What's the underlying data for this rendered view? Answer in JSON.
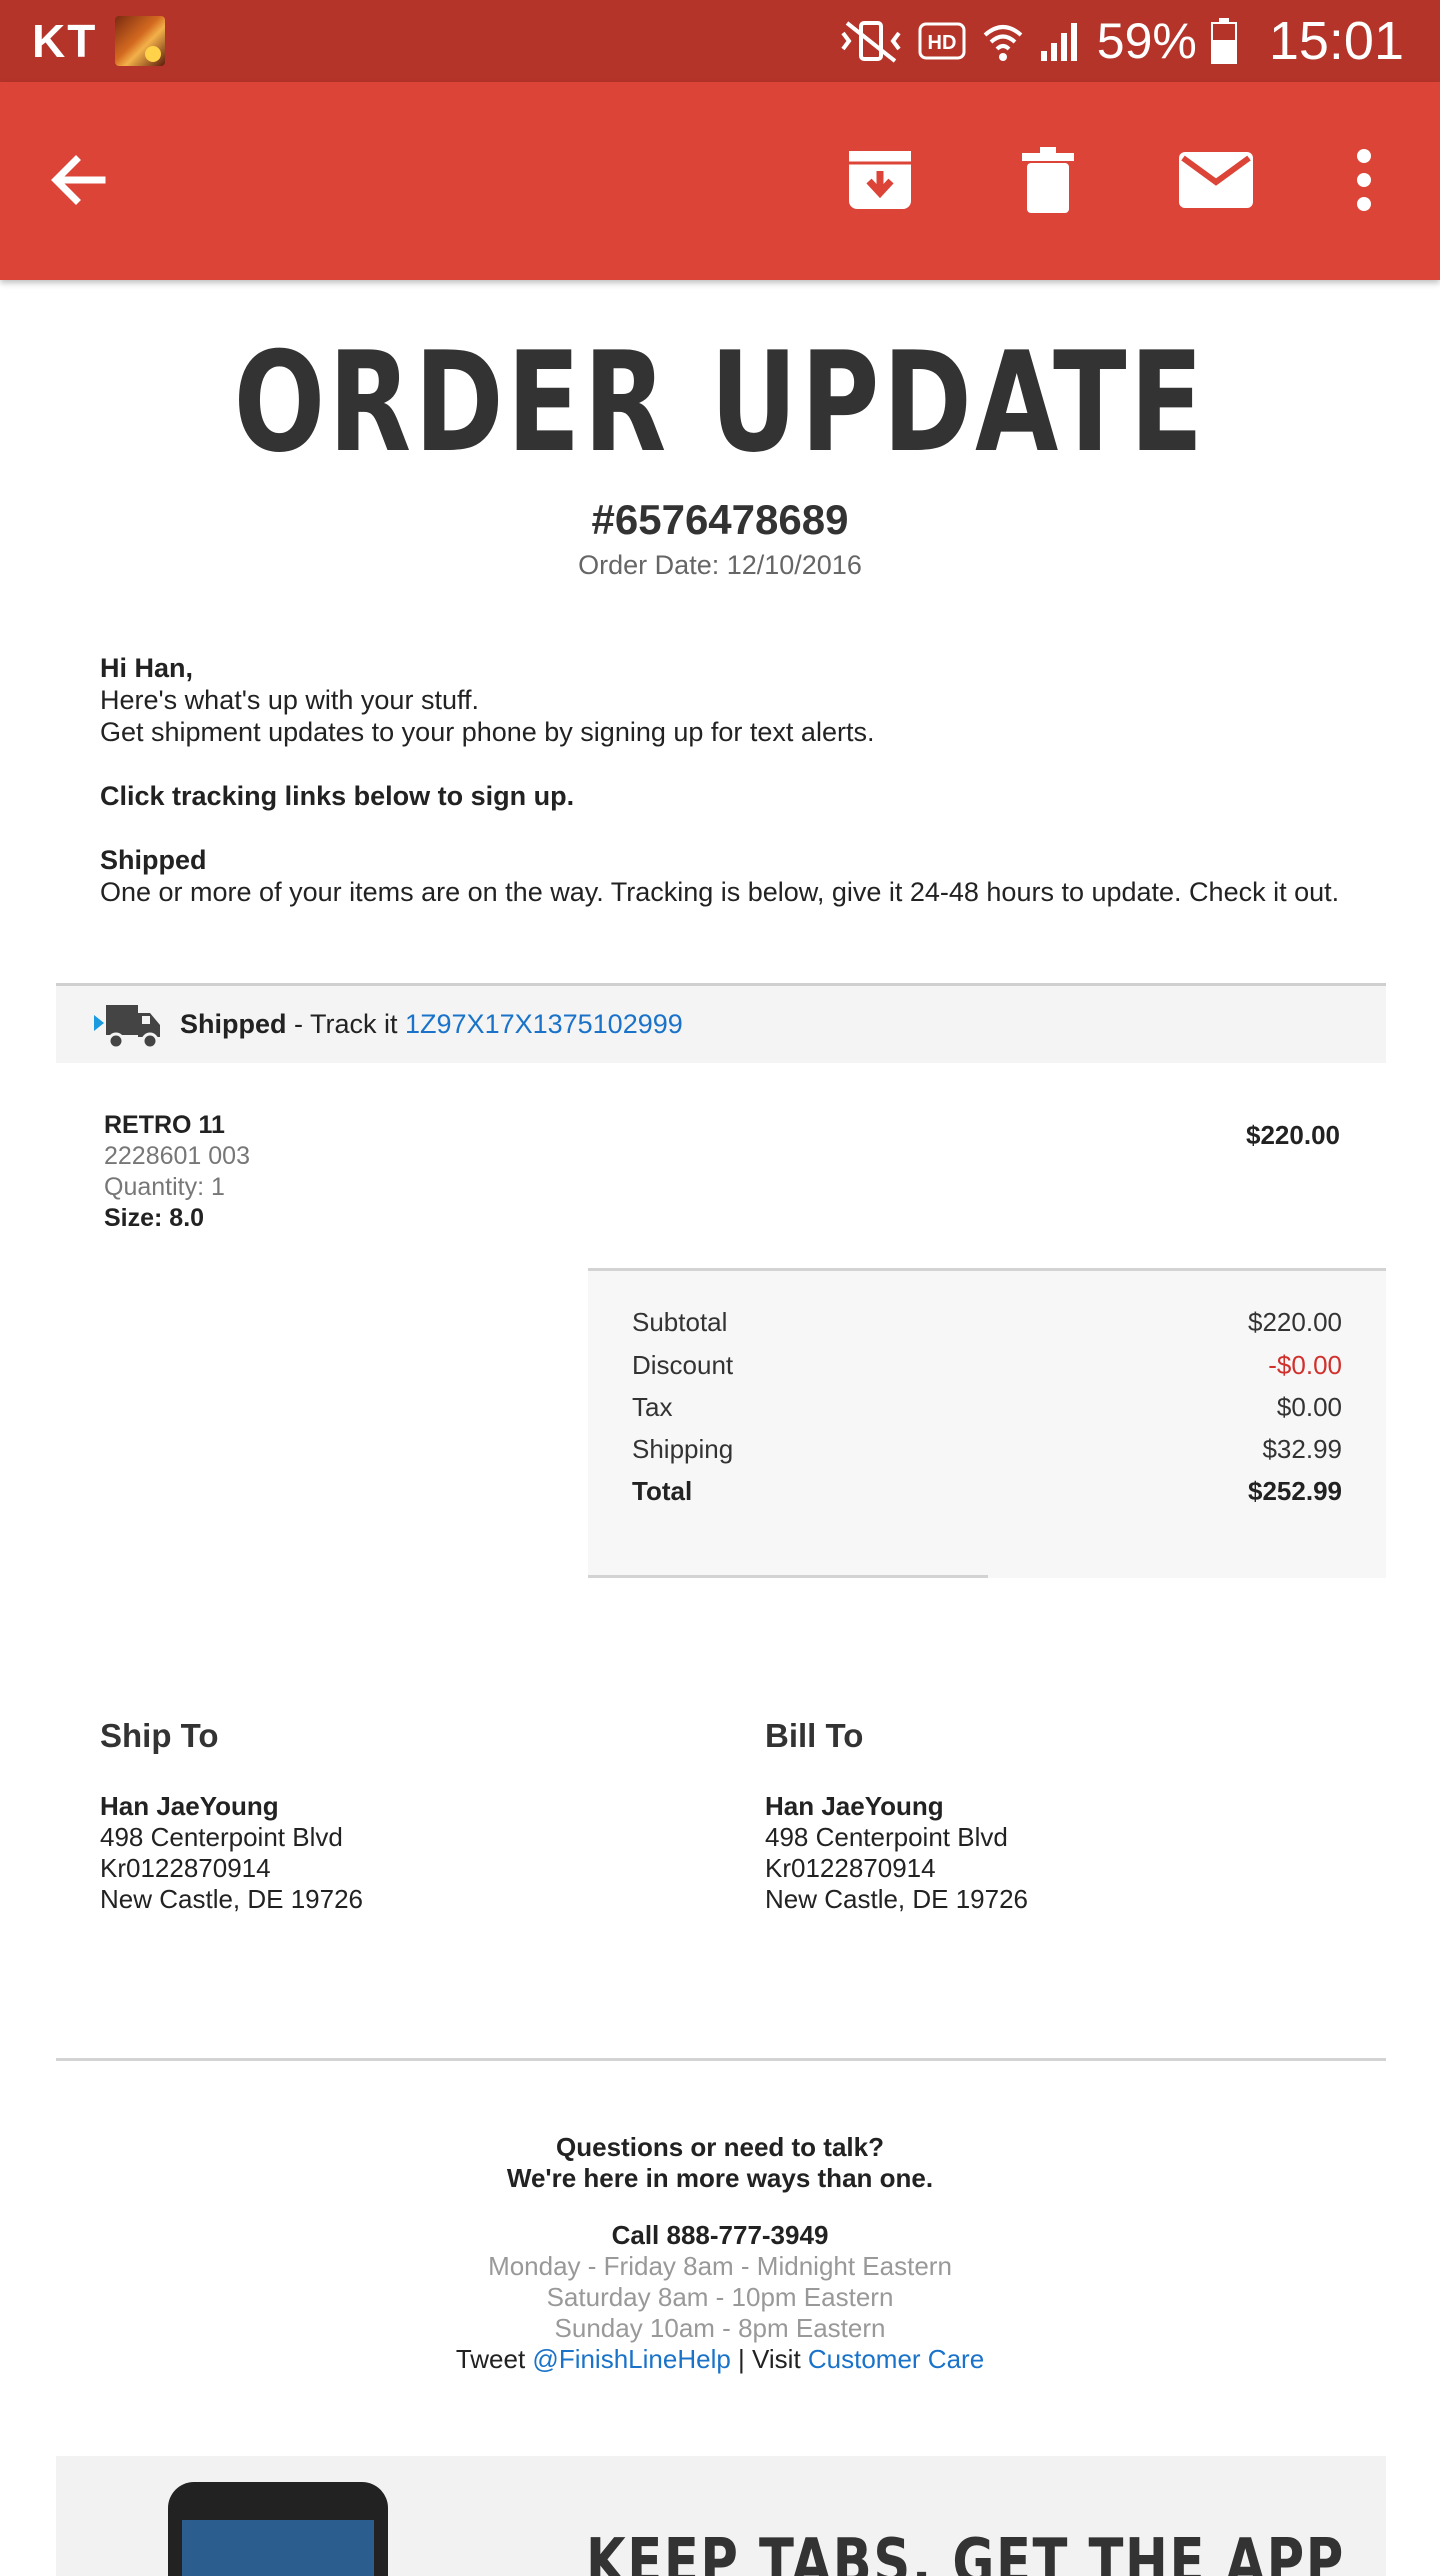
{
  "status_bar": {
    "carrier": "KT",
    "battery": "59%",
    "time": "15:01",
    "icons": [
      "avatar",
      "vibrate-mute-icon",
      "hd-icon",
      "wifi-icon",
      "signal-icon",
      "battery-icon"
    ]
  },
  "toolbar": {
    "icons": [
      "back-arrow-icon",
      "archive-icon",
      "delete-icon",
      "mark-unread-icon",
      "more-vert-icon"
    ]
  },
  "email": {
    "headline": "ORDER UPDATE",
    "order_number": "#6576478689",
    "order_date": "Order Date: 12/10/2016",
    "greeting": "Hi Han,",
    "line1": "Here's what's up with your stuff.",
    "line2": "Get shipment updates to your phone by signing up for text alerts.",
    "cta": "Click tracking links below to sign up.",
    "shipped_title": "Shipped",
    "shipped_desc": "One or more of your items are on the way. Tracking is below, give it 24-48 hours to update. Check it out.",
    "tracking": {
      "status": "Shipped",
      "prefix": " - Track it ",
      "number": "1Z97X17X1375102999"
    },
    "item": {
      "name": "RETRO 11",
      "sku": "2228601 003",
      "quantity": "Quantity: 1",
      "size": "Size: 8.0",
      "price": "$220.00"
    },
    "totals": [
      {
        "label": "Subtotal",
        "value": "$220.00"
      },
      {
        "label": "Discount",
        "value": "-$0.00"
      },
      {
        "label": "Tax",
        "value": "$0.00"
      },
      {
        "label": "Shipping",
        "value": "$32.99"
      },
      {
        "label": "Total",
        "value": "$252.99"
      }
    ],
    "ship_to": {
      "title": "Ship To",
      "name": "Han JaeYoung",
      "street": "498 Centerpoint Blvd",
      "line3": "Kr0122870914",
      "city": "New Castle, DE 19726"
    },
    "bill_to": {
      "title": "Bill To",
      "name": "Han JaeYoung",
      "street": "498 Centerpoint Blvd",
      "line3": "Kr0122870914",
      "city": "New Castle, DE 19726"
    },
    "footer": {
      "q1": "Questions or need to talk?",
      "q2": "We're here in more ways than one.",
      "call": "Call 888-777-3949",
      "hours1": "Monday - Friday 8am - Midnight Eastern",
      "hours2": "Saturday 8am - 10pm Eastern",
      "hours3": "Sunday 10am - 8pm Eastern",
      "tweet_prefix": "Tweet ",
      "tweet_handle": "@FinishLineHelp",
      "visit_prefix": " | Visit ",
      "visit_link": "Customer Care"
    },
    "banner_text": "KEEP TABS. GET THE APP"
  },
  "colors": {
    "status_bar": "#b5342a",
    "toolbar": "#db4437",
    "link": "#1a73c9",
    "negative": "#d0312d"
  }
}
